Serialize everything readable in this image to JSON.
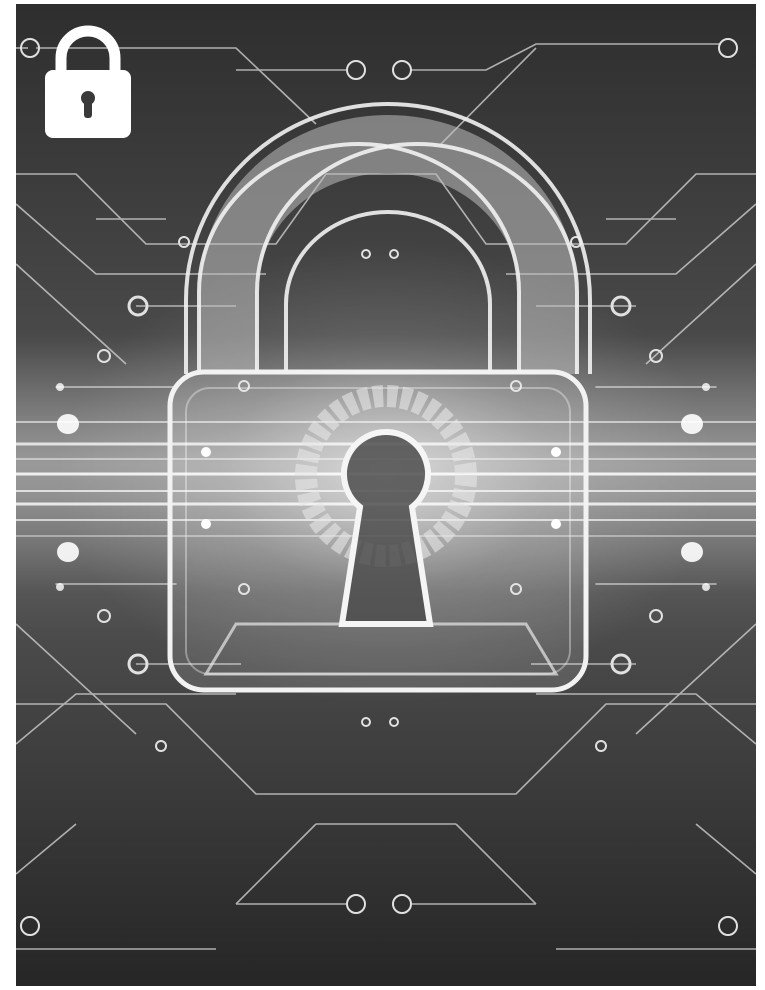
{
  "image": {
    "subject": "digital-padlock-circuit",
    "palette": {
      "background_dark": "#2b2b2b",
      "background_mid": "#4a4a4a",
      "glow": "#f4f4f4",
      "line": "#e8e8e8",
      "badge": "#ffffff"
    }
  },
  "badge": {
    "icon": "padlock-icon"
  }
}
